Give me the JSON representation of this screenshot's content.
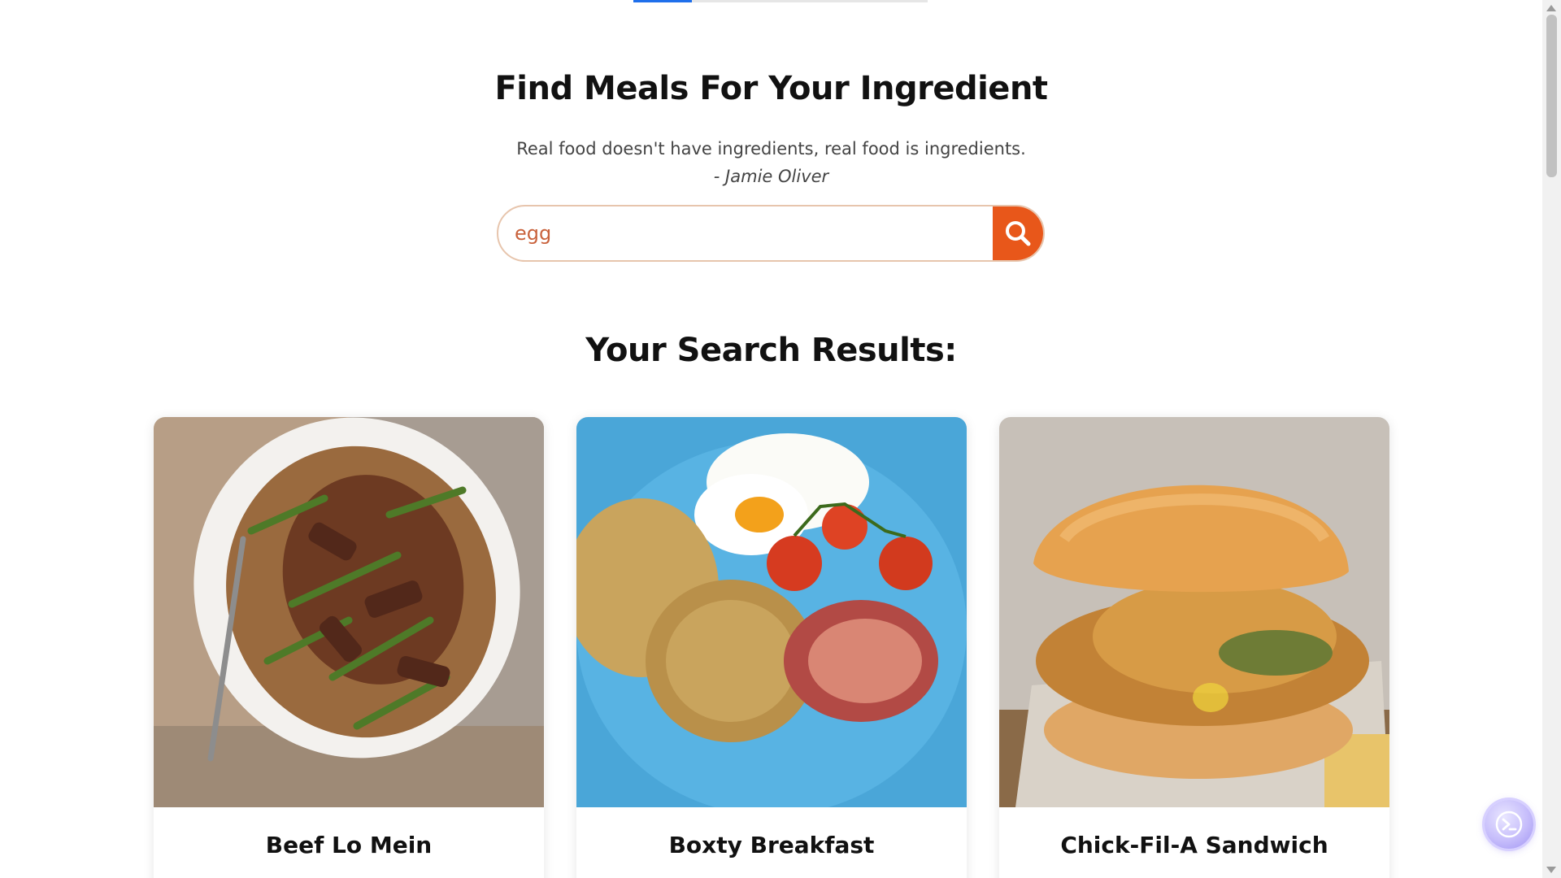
{
  "page": {
    "title": "Find Meals For Your Ingredient",
    "quote_text": "Real food doesn't have ingredients, real food is ingredients.",
    "quote_author": "- Jamie Oliver"
  },
  "search": {
    "value": "egg",
    "button_icon": "search-icon"
  },
  "results": {
    "title": "Your Search Results:",
    "cards": [
      {
        "title": "Beef Lo Mein"
      },
      {
        "title": "Boxty Breakfast"
      },
      {
        "title": "Chick-Fil-A Sandwich"
      }
    ]
  },
  "colors": {
    "accent": "#e8571a",
    "search_border": "#e7c5ad",
    "input_text": "#c9623c"
  }
}
